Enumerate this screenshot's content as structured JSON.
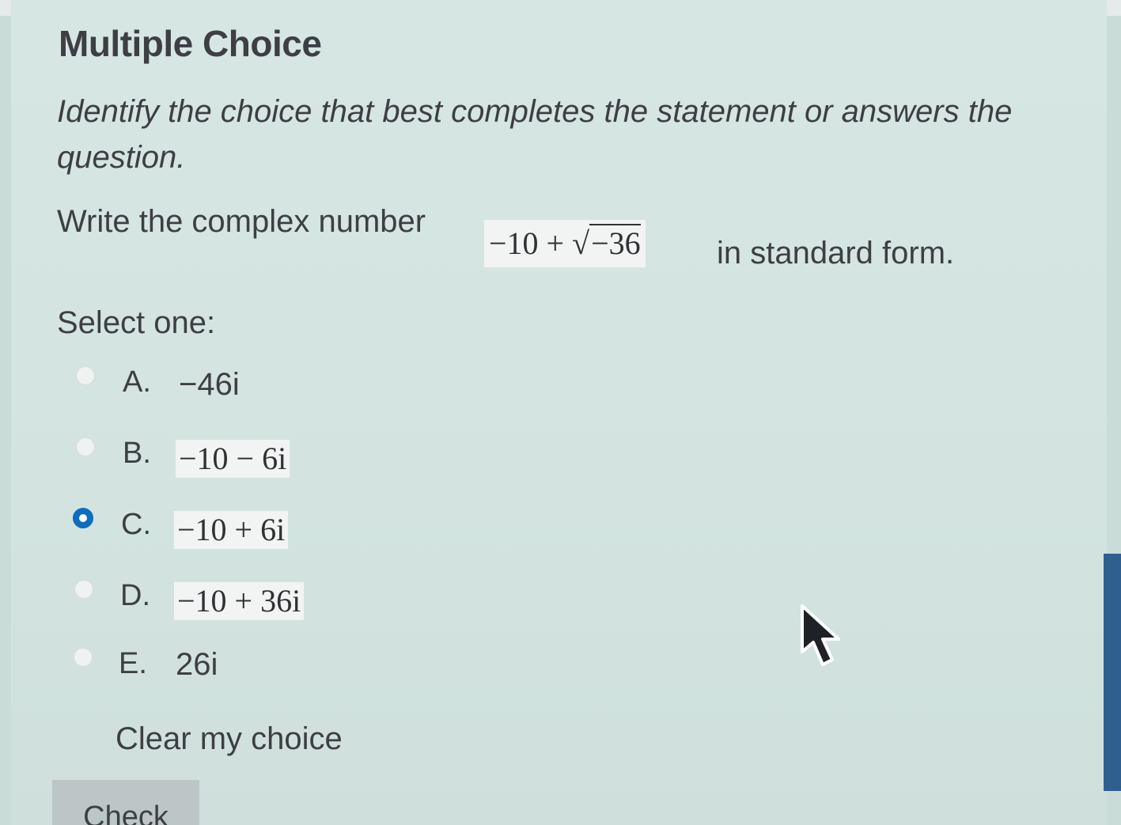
{
  "section": {
    "title": "Multiple Choice",
    "instruction": "Identify the choice that best completes the statement or answers the question."
  },
  "question": {
    "prefix": "Write the complex number",
    "expr_lead": "−10 +",
    "expr_radicand": "−36",
    "suffix": "in standard form."
  },
  "select_label": "Select one:",
  "options": [
    {
      "letter": "A.",
      "text": "−46i",
      "checked": false
    },
    {
      "letter": "B.",
      "text": "−10 − 6i",
      "checked": false
    },
    {
      "letter": "C.",
      "text": "−10 + 6i",
      "checked": true
    },
    {
      "letter": "D.",
      "text": "−10 + 36i",
      "checked": false
    },
    {
      "letter": "E.",
      "text": "26i",
      "checked": false
    }
  ],
  "clear_choice": "Clear my choice",
  "check_button": "Check",
  "colors": {
    "accent": "#0f6cbf",
    "text": "#3d3f44",
    "background": "#d6e6e3"
  }
}
